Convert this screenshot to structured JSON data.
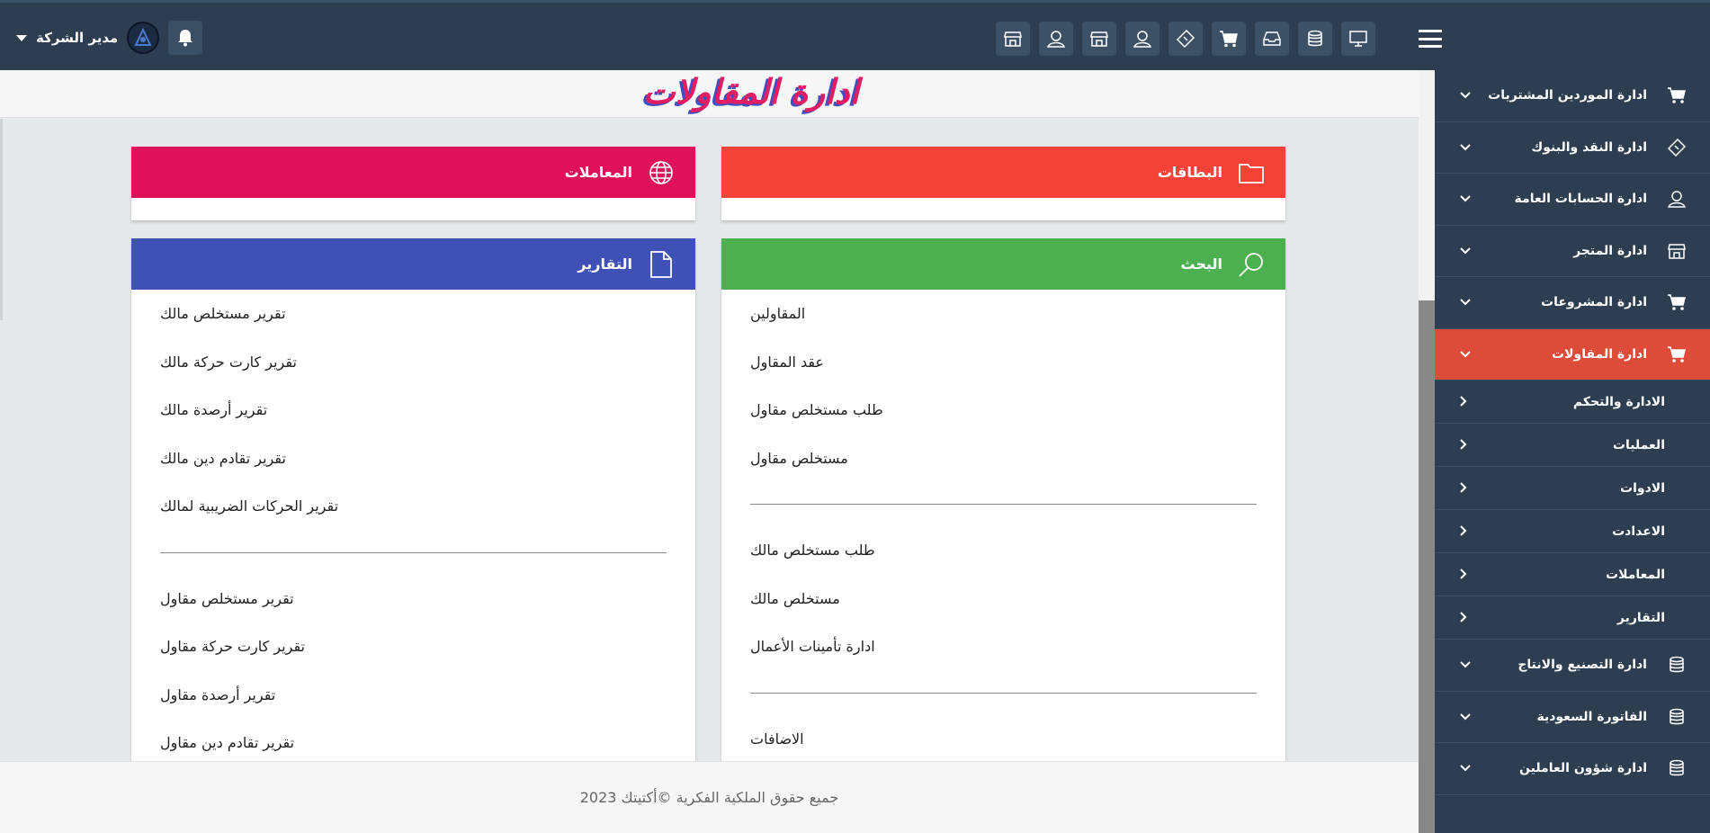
{
  "topbar": {
    "user_name": "مدير الشركة",
    "icons": [
      "monitor-icon",
      "database-icon",
      "inbox-icon",
      "cart-icon",
      "ticket-icon",
      "user-icon",
      "store-icon",
      "user-icon",
      "store-icon"
    ]
  },
  "page": {
    "title": "ادارة المقاولات"
  },
  "sidebar": {
    "items": [
      {
        "label": "ادارة الموردين المشتريات",
        "icon": "cart-icon"
      },
      {
        "label": "ادارة النقد والبنوك",
        "icon": "ticket-icon"
      },
      {
        "label": "ادارة الحسابات العامة",
        "icon": "user-icon"
      },
      {
        "label": "ادارة المتجر",
        "icon": "store-icon"
      },
      {
        "label": "ادارة المشروعات",
        "icon": "cart-icon"
      },
      {
        "label": "ادارة المقاولات",
        "icon": "cart-icon",
        "active": true
      }
    ],
    "subitems": [
      {
        "label": "الادارة والتحكم"
      },
      {
        "label": "العمليات"
      },
      {
        "label": "الادوات"
      },
      {
        "label": "الاعدادت"
      },
      {
        "label": "المعاملات"
      },
      {
        "label": "التقارير"
      }
    ],
    "items_after": [
      {
        "label": "ادارة التصنيع والانتاج",
        "icon": "database-icon"
      },
      {
        "label": "الفاتورة السعودية",
        "icon": "database-icon"
      },
      {
        "label": "ادارة شؤون العاملين",
        "icon": "database-icon"
      }
    ]
  },
  "cards": {
    "cards_title": "البطاقات",
    "transactions_title": "المعاملات",
    "search": {
      "title": "البحث",
      "group1": [
        "المقاولين",
        "عقد المقاول",
        "طلب مستخلص مقاول",
        "مستخلص مقاول"
      ],
      "group2": [
        "طلب مستخلص مالك",
        "مستخلص مالك",
        "ادارة تأمينات الأعمال"
      ],
      "group3": [
        "الاضافات"
      ]
    },
    "reports": {
      "title": "التقارير",
      "group1": [
        "تقرير مستخلص مالك",
        "تقرير كارت حركة مالك",
        "تقرير أرصدة مالك",
        "تقرير تقادم دين مالك",
        "تقرير الحركات الضريبية لمالك"
      ],
      "group2": [
        "تقرير مستخلص مقاول",
        "تقرير كارت حركة مقاول",
        "تقرير أرصدة مقاول",
        "تقرير تقادم دين مقاول"
      ]
    }
  },
  "colors": {
    "cards": "#f44336",
    "transactions": "#df1158",
    "search": "#4caf50",
    "reports": "#3f51b5",
    "sidebar_active": "#dd4b39",
    "sidebar_bg": "#2c3e50"
  },
  "footer": {
    "text": "جميع حقوق الملكية الفكرية ©أكتيتك 2023"
  }
}
